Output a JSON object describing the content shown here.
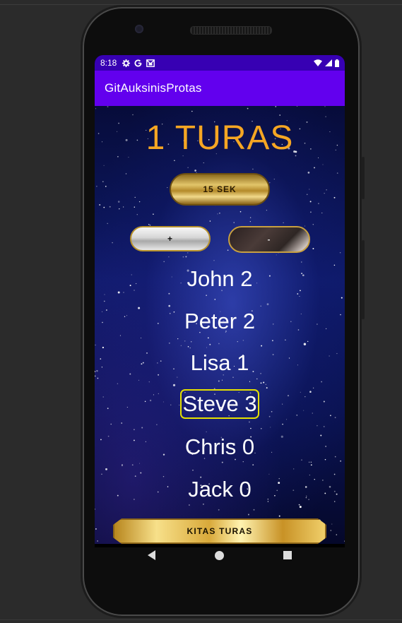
{
  "status_bar": {
    "time": "8:18",
    "icons": [
      "settings-icon",
      "google-icon",
      "gmail-icon"
    ],
    "right_icons": [
      "wifi-icon",
      "signal-icon",
      "battery-icon"
    ]
  },
  "app_bar": {
    "title": "GitAuksinisProtas"
  },
  "round": {
    "title": "1 TURAS"
  },
  "timer": {
    "label": "15 SEK"
  },
  "controls": {
    "plus_label": "+",
    "minus_label": "-"
  },
  "players": [
    {
      "name": "John",
      "score": "2",
      "text": "John 2",
      "selected": false
    },
    {
      "name": "Peter",
      "score": "2",
      "text": "Peter 2",
      "selected": false
    },
    {
      "name": "Lisa",
      "score": "1",
      "text": "Lisa 1",
      "selected": false
    },
    {
      "name": "Steve",
      "score": "3",
      "text": "Steve 3",
      "selected": true
    },
    {
      "name": "Chris",
      "score": "0",
      "text": "Chris 0",
      "selected": false
    },
    {
      "name": "Jack",
      "score": "0",
      "text": "Jack 0",
      "selected": false
    }
  ],
  "next_round": {
    "label": "KITAS TURAS"
  },
  "nav": {
    "items": [
      "back-icon",
      "home-icon",
      "recents-icon"
    ]
  },
  "colors": {
    "status_bar": "#3700b3",
    "app_bar": "#6200ee",
    "round_title": "#f5a623",
    "selected_outline": "#e5e000"
  }
}
